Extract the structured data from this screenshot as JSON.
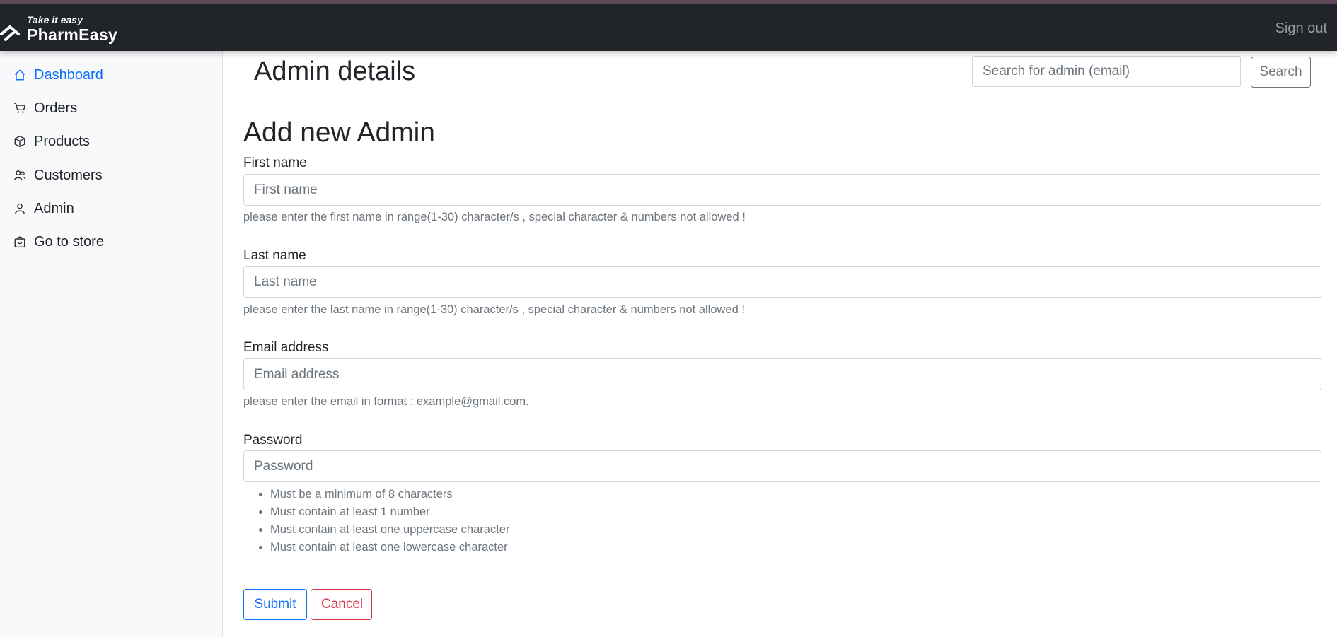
{
  "brand": {
    "tagline": "Take it easy",
    "name": "PharmEasy"
  },
  "navbar": {
    "sign_out": "Sign out"
  },
  "sidebar": {
    "items": [
      {
        "label": "Dashboard",
        "icon": "home-icon",
        "active": true
      },
      {
        "label": "Orders",
        "icon": "cart-icon",
        "active": false
      },
      {
        "label": "Products",
        "icon": "box-icon",
        "active": false
      },
      {
        "label": "Customers",
        "icon": "people-icon",
        "active": false
      },
      {
        "label": "Admin",
        "icon": "person-icon",
        "active": false
      },
      {
        "label": "Go to store",
        "icon": "bag-icon",
        "active": false
      }
    ]
  },
  "header": {
    "title": "Admin details",
    "search_placeholder": "Search for admin (email)",
    "search_button": "Search"
  },
  "form": {
    "heading": "Add new Admin",
    "first_name": {
      "label": "First name",
      "placeholder": "First name",
      "help": "please enter the first name in range(1-30) character/s , special character & numbers not allowed !"
    },
    "last_name": {
      "label": "Last name",
      "placeholder": "Last name",
      "help": "please enter the last name in range(1-30) character/s , special character & numbers not allowed !"
    },
    "email": {
      "label": "Email address",
      "placeholder": "Email address",
      "help": "please enter the email in format : example@gmail.com."
    },
    "password": {
      "label": "Password",
      "placeholder": "Password",
      "rules": [
        "Must be a minimum of 8 characters",
        "Must contain at least 1 number",
        "Must contain at least one uppercase character",
        "Must contain at least one lowercase character"
      ]
    },
    "submit_button": "Submit",
    "cancel_button": "Cancel"
  },
  "colors": {
    "navbar": "#212529",
    "accent": "#0d6efd",
    "danger": "#dc3545",
    "muted": "#6c757d"
  }
}
